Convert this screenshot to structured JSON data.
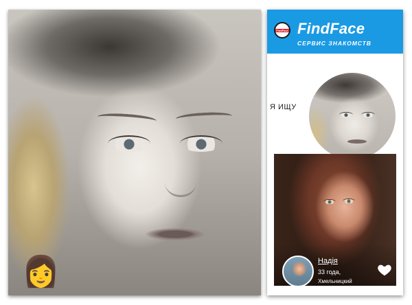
{
  "left_photo": {
    "emoji": "👩"
  },
  "app": {
    "logo_text": "FindFace",
    "brand_name": "FindFace",
    "tagline": "СЕРВИС ЗНАКОМСТВ",
    "search_label": "Я ИЩУ",
    "match": {
      "name": "Надія",
      "age": "33 года,",
      "city": "Хмельницкий"
    },
    "colors": {
      "header_blue": "#1b9ae4",
      "logo_red": "#d8262b"
    }
  }
}
